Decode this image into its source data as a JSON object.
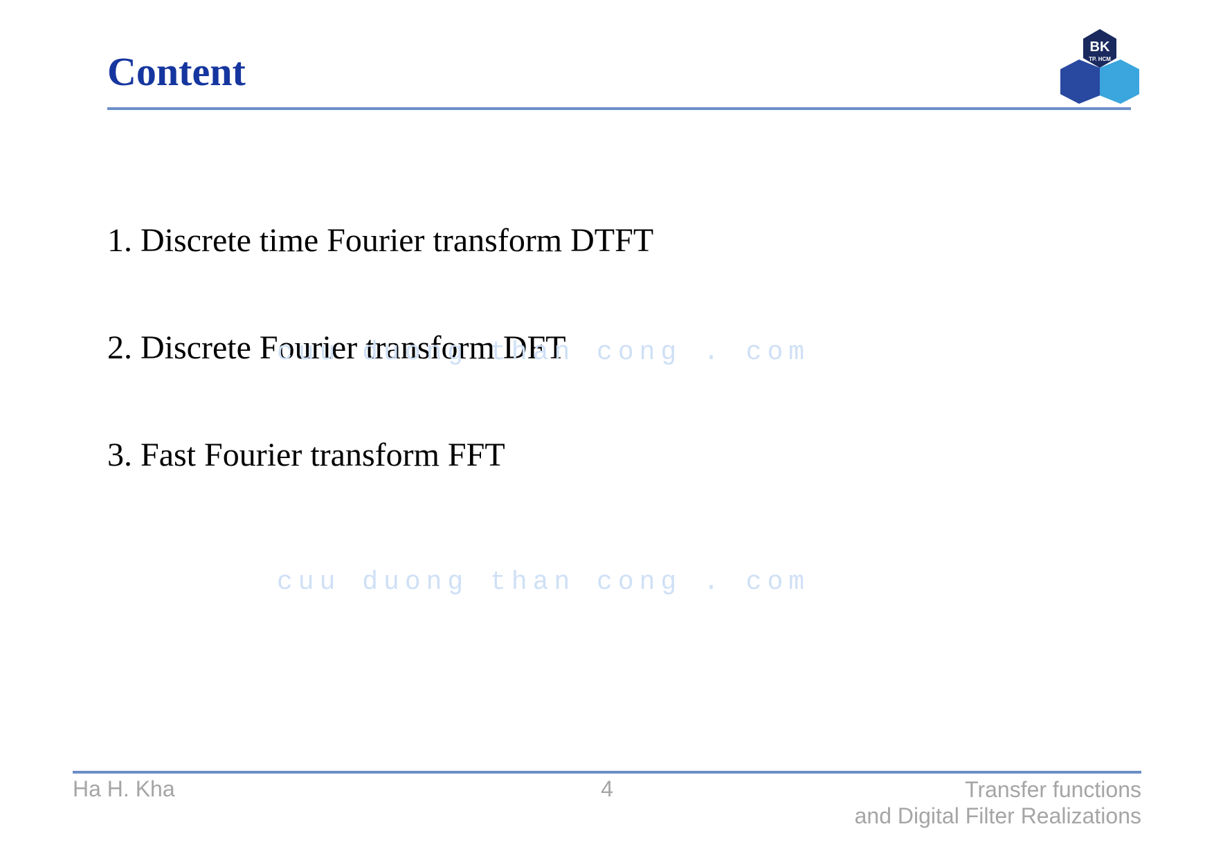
{
  "header": {
    "title": "Content"
  },
  "logo": {
    "text_top": "BK",
    "text_bottom": "TP. HCM"
  },
  "content": {
    "items": [
      "1. Discrete time Fourier transform DTFT",
      "2. Discrete Fourier transform DFT",
      "3. Fast Fourier transform FFT"
    ]
  },
  "watermark": "cuu duong than cong . com",
  "footer": {
    "left": "Ha H. Kha",
    "center": "4",
    "right_line1": "Transfer functions",
    "right_line2": "and Digital Filter Realizations"
  },
  "colors": {
    "title": "#16369f",
    "rule": "#6c8ec6",
    "watermark": "#cfe0f6",
    "footer_text": "#a5a5a5",
    "logo_dark": "#1a2a5e",
    "logo_mid": "#2948a0",
    "logo_light": "#3aa6dd"
  }
}
